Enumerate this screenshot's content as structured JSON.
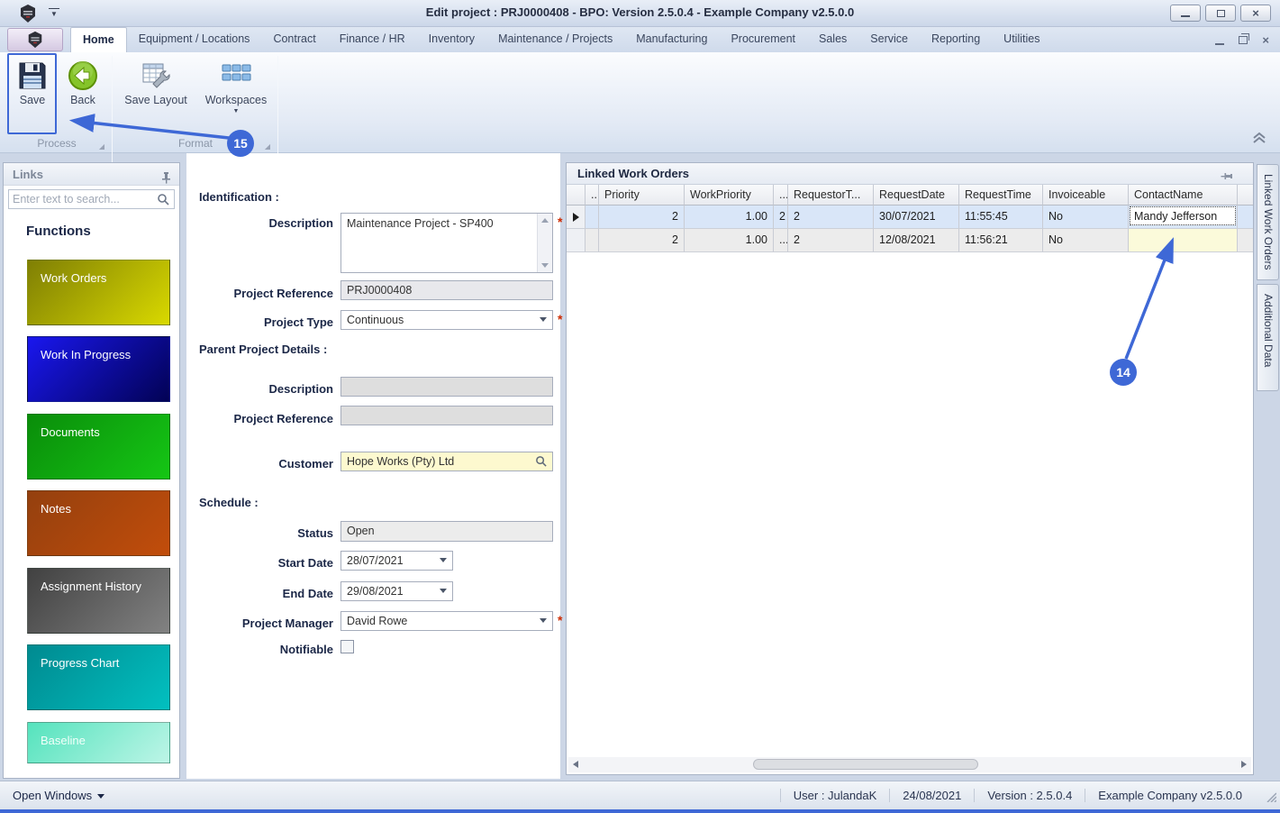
{
  "titlebar": {
    "title": "Edit project : PRJ0000408 - BPO: Version 2.5.0.4 - Example Company v2.5.0.0"
  },
  "ribbon": {
    "tabs": [
      "Home",
      "Equipment / Locations",
      "Contract",
      "Finance / HR",
      "Inventory",
      "Maintenance / Projects",
      "Manufacturing",
      "Procurement",
      "Sales",
      "Service",
      "Reporting",
      "Utilities"
    ],
    "active_tab": "Home",
    "buttons": {
      "save": "Save",
      "back": "Back",
      "save_layout": "Save Layout",
      "workspaces": "Workspaces"
    },
    "groups": {
      "process": "Process",
      "format": "Format"
    }
  },
  "links": {
    "title": "Links",
    "search_placeholder": "Enter text to search...",
    "heading": "Functions",
    "tiles": [
      {
        "label": "Work Orders",
        "from": "#7f7f04",
        "to": "#d9d900"
      },
      {
        "label": "Work In Progress",
        "from": "#1a17ef",
        "to": "#020254"
      },
      {
        "label": "Documents",
        "from": "#0a8d0a",
        "to": "#15c615"
      },
      {
        "label": "Notes",
        "from": "#94400e",
        "to": "#c24d0b"
      },
      {
        "label": "Assignment History",
        "from": "#414141",
        "to": "#828282"
      },
      {
        "label": "Progress Chart",
        "from": "#008a90",
        "to": "#02c0c0"
      },
      {
        "label": "Baseline",
        "from": "#55e3bd",
        "to": "#bdf5e7"
      }
    ]
  },
  "form": {
    "identification_heading": "Identification :",
    "description_label": "Description",
    "description_value": "Maintenance Project - SP400",
    "project_reference_label": "Project Reference",
    "project_reference_value": "PRJ0000408",
    "project_type_label": "Project Type",
    "project_type_value": "Continuous",
    "parent_heading": "Parent Project Details :",
    "parent_description_label": "Description",
    "parent_description_value": "",
    "parent_reference_label": "Project Reference",
    "parent_reference_value": "",
    "customer_label": "Customer",
    "customer_value": "Hope Works (Pty) Ltd",
    "schedule_heading": "Schedule :",
    "status_label": "Status",
    "status_value": "Open",
    "start_date_label": "Start Date",
    "start_date_value": "28/07/2021",
    "end_date_label": "End Date",
    "end_date_value": "29/08/2021",
    "project_manager_label": "Project Manager",
    "project_manager_value": "David Rowe",
    "notifiable_label": "Notifiable",
    "required_marker": "*"
  },
  "grid": {
    "title": "Linked Work Orders",
    "columns": [
      "..",
      "Priority",
      "WorkPriority",
      "...",
      "RequestorT...",
      "RequestDate",
      "RequestTime",
      "Invoiceable",
      "ContactName"
    ],
    "rows": [
      {
        "priority": "2",
        "work_priority": "1.00",
        "c3": "2",
        "requestor": "2",
        "request_date": "30/07/2021",
        "request_time": "11:55:45",
        "invoiceable": "No",
        "contact_name": "Mandy Jefferson"
      },
      {
        "priority": "2",
        "work_priority": "1.00",
        "c3": "...",
        "requestor": "2",
        "request_date": "12/08/2021",
        "request_time": "11:56:21",
        "invoiceable": "No",
        "contact_name": ""
      }
    ]
  },
  "side_tabs": {
    "tab1": "Linked Work Orders",
    "tab2": "Additional Data"
  },
  "statusbar": {
    "open_windows": "Open Windows",
    "user": "User : JulandaK",
    "date": "24/08/2021",
    "version": "Version : 2.5.0.4",
    "company": "Example Company v2.5.0.0"
  },
  "annotations": {
    "n14": "14",
    "n15": "15",
    "color": "#3e68d6"
  }
}
